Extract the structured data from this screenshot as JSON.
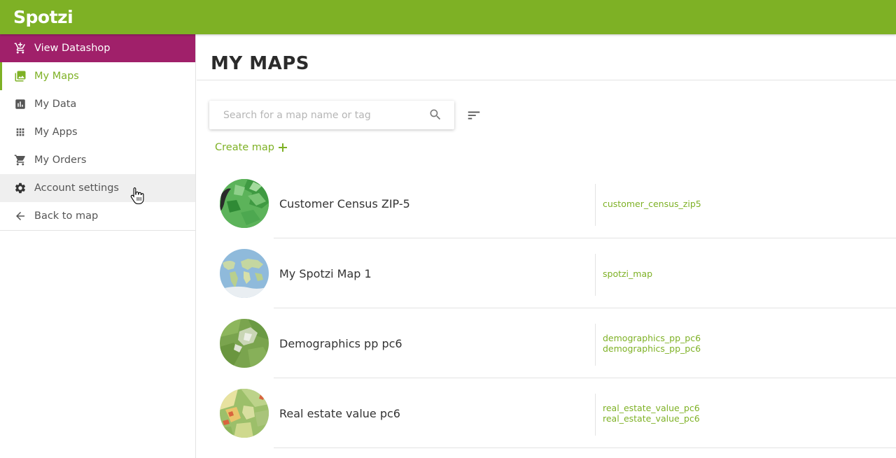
{
  "app": {
    "logo_text": "Spotzi",
    "brand_color": "#7eb125",
    "datashop_color": "#a0206a"
  },
  "sidebar": {
    "items": [
      {
        "label": "View Datashop",
        "icon": "cart-plus-icon"
      },
      {
        "label": "My Maps",
        "icon": "image-icon"
      },
      {
        "label": "My Data",
        "icon": "bar-chart-icon"
      },
      {
        "label": "My Apps",
        "icon": "apps-grid-icon"
      },
      {
        "label": "My Orders",
        "icon": "cart-icon"
      },
      {
        "label": "Account settings",
        "icon": "gear-icon"
      },
      {
        "label": "Back to map",
        "icon": "arrow-left-icon"
      }
    ]
  },
  "main": {
    "title": "MY MAPS",
    "search": {
      "placeholder": "Search for a map name or tag",
      "value": ""
    },
    "create_map_label": "Create map",
    "maps": [
      {
        "name": "Customer Census ZIP-5",
        "tags": [
          "customer_census_zip5"
        ]
      },
      {
        "name": "My Spotzi Map 1",
        "tags": [
          "spotzi_map"
        ]
      },
      {
        "name": "Demographics pp pc6",
        "tags": [
          "demographics_pp_pc6",
          "demographics_pp_pc6"
        ]
      },
      {
        "name": "Real estate value pc6",
        "tags": [
          "real_estate_value_pc6",
          "real_estate_value_pc6"
        ]
      }
    ]
  }
}
